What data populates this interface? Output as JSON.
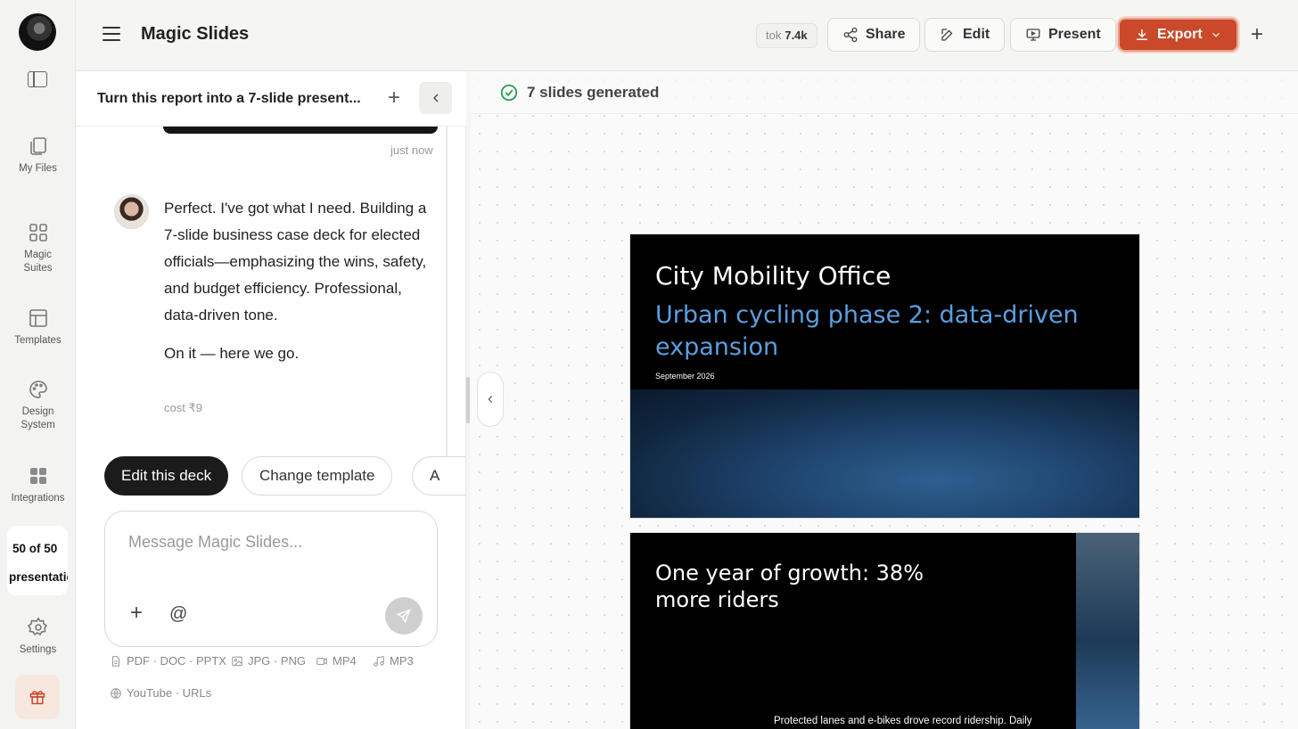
{
  "rail": {
    "items": [
      {
        "label": "My Files",
        "icon": "files-icon"
      },
      {
        "label": "Magic Suites",
        "icon": "grid-icon"
      },
      {
        "label": "Templates",
        "icon": "templates-icon"
      },
      {
        "label": "Design System",
        "icon": "palette-icon"
      },
      {
        "label": "Integrations",
        "icon": "integrations-icon"
      }
    ],
    "quota_count": "50 of 50",
    "quota_label": "presentations",
    "settings_label": "Settings"
  },
  "topbar": {
    "title": "Magic Slides",
    "tok_label": "tok",
    "tok_value": "7.4k",
    "share_label": "Share",
    "edit_label": "Edit",
    "present_label": "Present",
    "export_label": "Export"
  },
  "chat": {
    "title": "Turn this report into a 7-slide present...",
    "timestamp": "just now",
    "message": "Perfect. I've got what I need. Building a 7-slide business case deck for elected officials—emphasizing the wins, safety, and budget efficiency. Professional, data-driven tone.",
    "message2": "On it — here we go.",
    "cost": "cost ₹9",
    "chips": [
      "Edit this deck",
      "Change template",
      "A"
    ],
    "composer_placeholder": "Message Magic Slides...",
    "file_types": [
      "PDF · DOC · PPTX",
      "JPG · PNG",
      "MP4",
      "MP3",
      "YouTube · URLs"
    ]
  },
  "canvas": {
    "status": "7 slides generated",
    "slides": [
      {
        "org": "City Mobility Office",
        "title": "Urban cycling phase 2: data-driven expansion",
        "date": "September 2026"
      },
      {
        "title": "One year of growth: 38% more riders",
        "body": "Protected lanes and e-bikes drove record ridership. Daily"
      }
    ]
  },
  "colors": {
    "accent": "#c9492a",
    "slide_title_blue": "#5b9fe0",
    "check_green": "#2e9a5a"
  }
}
